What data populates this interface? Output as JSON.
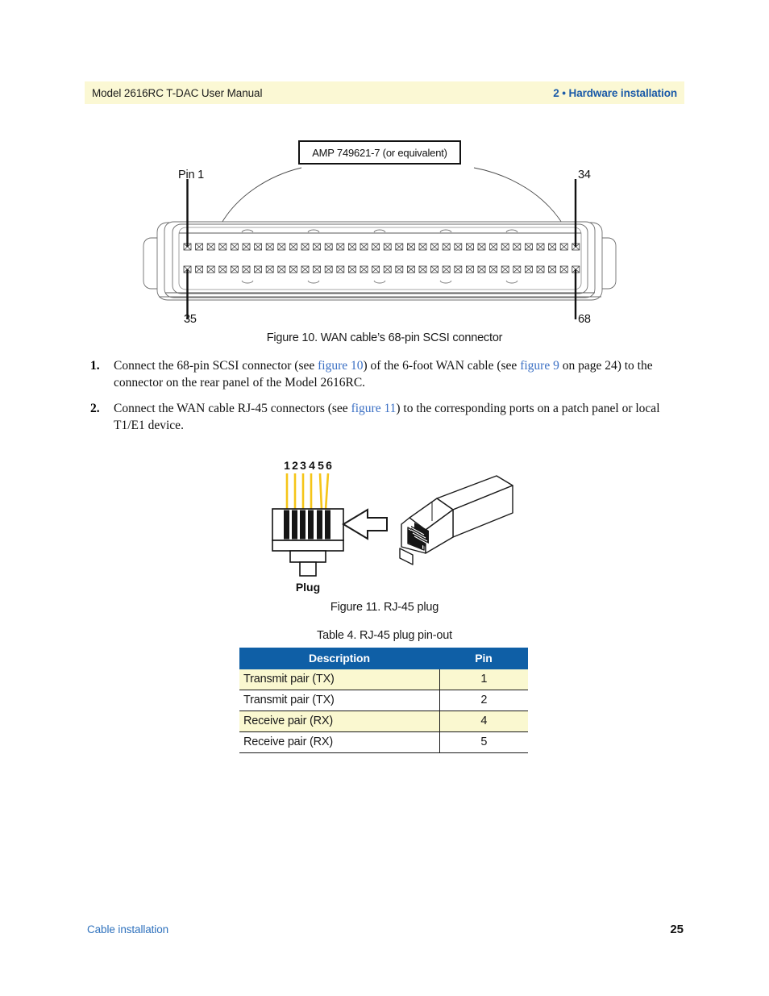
{
  "header": {
    "left": "Model 2616RC T-DAC User Manual",
    "right": "2 • Hardware installation",
    "accent": "#1a5aa8",
    "band_color": "#fbf8d4"
  },
  "figure10": {
    "callout": "AMP 749621-7 (or equivalent)",
    "labels": {
      "pin1": "Pin 1",
      "pin34": "34",
      "pin35": "35",
      "pin68": "68"
    },
    "pins_per_row": 34,
    "rows": 2,
    "caption": "Figure 10. WAN cable’s 68-pin SCSI connector"
  },
  "steps": [
    {
      "number": "1.",
      "parts": [
        {
          "text": "Connect the 68-pin SCSI connector (see ",
          "link": false
        },
        {
          "text": "figure 10",
          "link": true
        },
        {
          "text": ") of the 6-foot WAN cable (see ",
          "link": false
        },
        {
          "text": "figure 9",
          "link": true
        },
        {
          "text": " on page 24) to the connector on the rear panel of the Model 2616RC.",
          "link": false
        }
      ]
    },
    {
      "number": "2.",
      "parts": [
        {
          "text": "Connect the WAN cable RJ-45 connectors (see ",
          "link": false
        },
        {
          "text": "figure 11",
          "link": true
        },
        {
          "text": ") to the corresponding ports on a patch panel or local T1/E1 device.",
          "link": false
        }
      ]
    }
  ],
  "figure11": {
    "wire_numbers": [
      "1",
      "2",
      "3",
      "4",
      "5",
      "6"
    ],
    "plug_label": "Plug",
    "wire_color": "#f5c518",
    "caption": "Figure 11. RJ-45 plug"
  },
  "table4": {
    "caption": "Table 4. RJ-45 plug pin-out",
    "header_color": "#0f5fa6",
    "alt_row_color": "#faf8d0",
    "columns": [
      "Description",
      "Pin"
    ],
    "rows": [
      {
        "description": "Transmit pair (TX)",
        "pin": "1"
      },
      {
        "description": "Transmit pair (TX)",
        "pin": "2"
      },
      {
        "description": "Receive pair (RX)",
        "pin": "4"
      },
      {
        "description": "Receive pair (RX)",
        "pin": "5"
      }
    ]
  },
  "footer": {
    "left": "Cable installation",
    "page_number": "25",
    "link_color": "#2f72bd"
  }
}
